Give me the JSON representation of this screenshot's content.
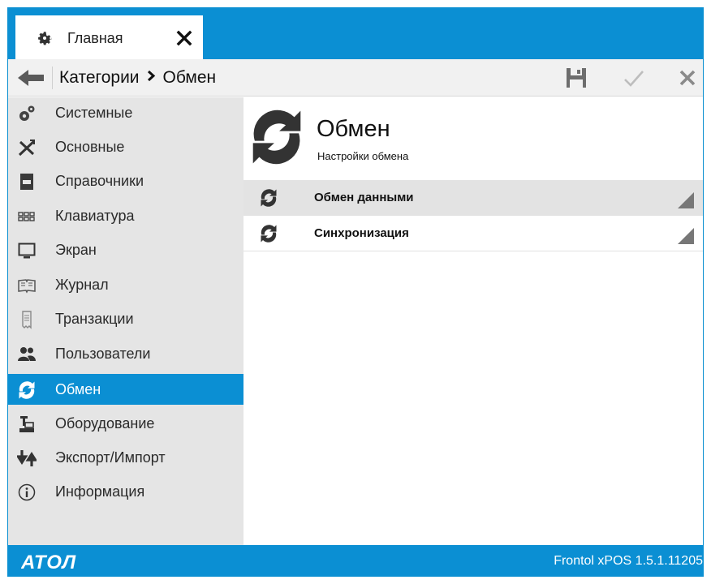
{
  "window": {
    "tab_title": "Главная",
    "tab_icon": "gear-icon",
    "controls": [
      "minimize-icon",
      "maximize-icon",
      "close-icon"
    ]
  },
  "breadcrumb": {
    "root": "Категории",
    "current": "Обмен",
    "separator_icon": "chevron-right-icon"
  },
  "toolbar": {
    "save_icon": "save-icon",
    "apply_icon": "check-icon",
    "cancel_icon": "close-icon"
  },
  "sidebar": {
    "items": [
      {
        "label": "Системные",
        "icon": "gears-icon"
      },
      {
        "label": "Основные",
        "icon": "tools-icon"
      },
      {
        "label": "Справочники",
        "icon": "book-icon"
      },
      {
        "label": "Клавиатура",
        "icon": "keyboard-icon"
      },
      {
        "label": "Экран",
        "icon": "monitor-icon"
      },
      {
        "label": "Журнал",
        "icon": "journal-icon"
      },
      {
        "label": "Транзакции",
        "icon": "receipt-icon"
      },
      {
        "label": "Пользователи",
        "icon": "users-icon"
      },
      {
        "label": "Обмен",
        "icon": "sync-icon",
        "active": true
      },
      {
        "label": "Оборудование",
        "icon": "cash-register-icon"
      },
      {
        "label": "Экспорт/Импорт",
        "icon": "export-import-icon"
      },
      {
        "label": "Информация",
        "icon": "info-icon"
      }
    ]
  },
  "content": {
    "title": "Обмен",
    "subtitle": "Настройки обмена",
    "rows": [
      {
        "label": "Обмен данными",
        "icon": "sync-icon",
        "selected": true
      },
      {
        "label": "Синхронизация",
        "icon": "sync-icon",
        "selected": false
      }
    ]
  },
  "footer": {
    "logo_text": "АТОЛ",
    "version": "Frontol xPOS 1.5.1.11205"
  },
  "colors": {
    "accent": "#0b8fd3",
    "sidebar_bg": "#e5e5e5",
    "selected_row": "#e3e3e3"
  }
}
